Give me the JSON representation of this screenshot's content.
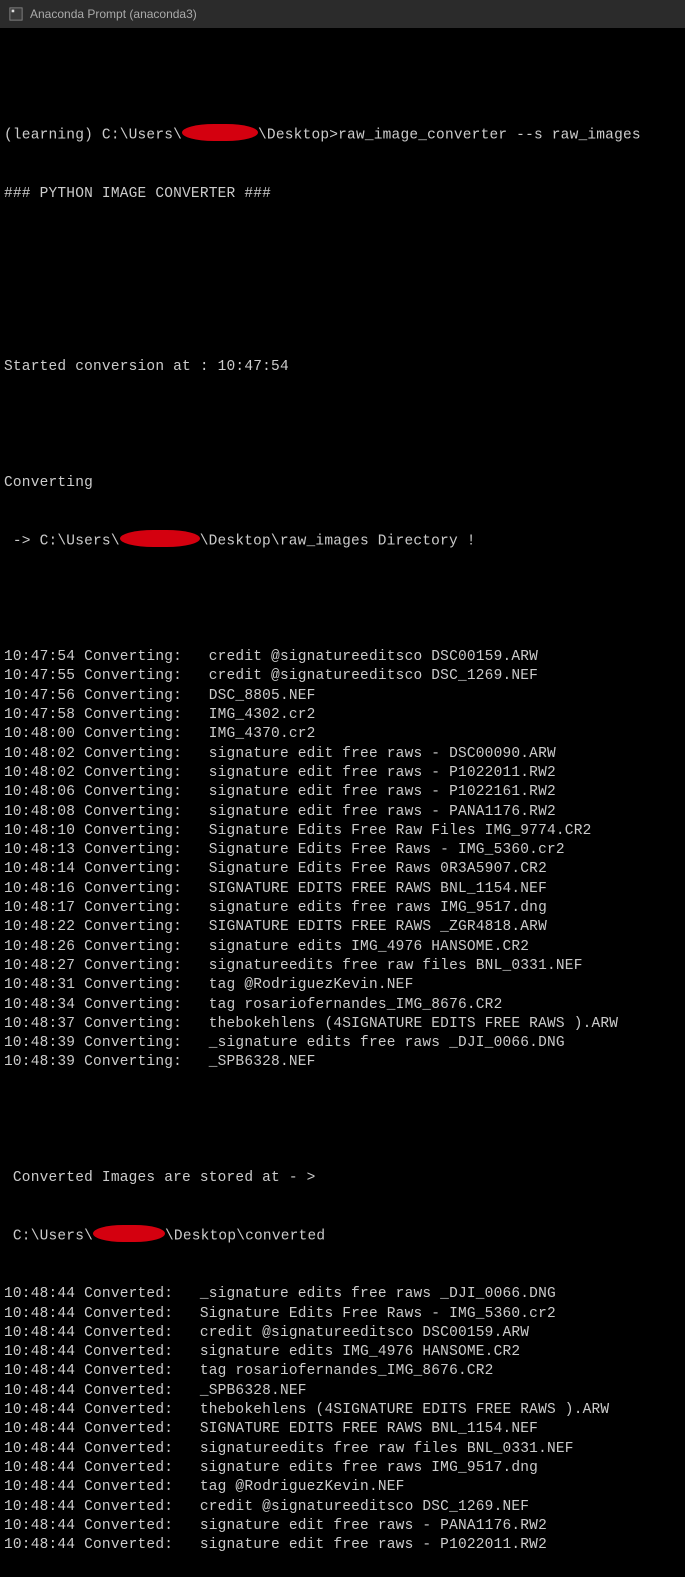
{
  "window": {
    "title": "Anaconda Prompt (anaconda3)"
  },
  "prompt": {
    "before_redact": "(learning) C:\\Users\\",
    "after_redact": "\\Desktop>raw_image_converter --s raw_images"
  },
  "header": "### PYTHON IMAGE CONVERTER ###",
  "started": "Started conversion at : 10:47:54",
  "converting_label": "Converting",
  "converting_dir": {
    "prefix": " -> C:\\Users\\",
    "suffix": "\\Desktop\\raw_images Directory !"
  },
  "converting_lines": [
    "10:47:54 Converting:   credit @signatureeditsco DSC00159.ARW",
    "10:47:55 Converting:   credit @signatureeditsco DSC_1269.NEF",
    "10:47:56 Converting:   DSC_8805.NEF",
    "10:47:58 Converting:   IMG_4302.cr2",
    "10:48:00 Converting:   IMG_4370.cr2",
    "10:48:02 Converting:   signature edit free raws - DSC00090.ARW",
    "10:48:02 Converting:   signature edit free raws - P1022011.RW2",
    "10:48:06 Converting:   signature edit free raws - P1022161.RW2",
    "10:48:08 Converting:   signature edit free raws - PANA1176.RW2",
    "10:48:10 Converting:   Signature Edits Free Raw Files IMG_9774.CR2",
    "10:48:13 Converting:   Signature Edits Free Raws - IMG_5360.cr2",
    "10:48:14 Converting:   Signature Edits Free Raws 0R3A5907.CR2",
    "10:48:16 Converting:   SIGNATURE EDITS FREE RAWS BNL_1154.NEF",
    "10:48:17 Converting:   signature edits free raws IMG_9517.dng",
    "10:48:22 Converting:   SIGNATURE EDITS FREE RAWS _ZGR4818.ARW",
    "10:48:26 Converting:   signature edits IMG_4976 HANSOME.CR2",
    "10:48:27 Converting:   signatureedits free raw files BNL_0331.NEF",
    "10:48:31 Converting:   tag @RodriguezKevin.NEF",
    "10:48:34 Converting:   tag rosariofernandes_IMG_8676.CR2",
    "10:48:37 Converting:   thebokehlens (4SIGNATURE EDITS FREE RAWS ).ARW",
    "10:48:39 Converting:   _signature edits free raws _DJI_0066.DNG",
    "10:48:39 Converting:   _SPB6328.NEF"
  ],
  "stored_at": " Converted Images are stored at - >",
  "stored_path": {
    "prefix": " C:\\Users\\",
    "suffix": "\\Desktop\\converted"
  },
  "converted_lines": [
    "10:48:44 Converted:   _signature edits free raws _DJI_0066.DNG",
    "10:48:44 Converted:   Signature Edits Free Raws - IMG_5360.cr2",
    "10:48:44 Converted:   credit @signatureeditsco DSC00159.ARW",
    "10:48:44 Converted:   signature edits IMG_4976 HANSOME.CR2",
    "10:48:44 Converted:   tag rosariofernandes_IMG_8676.CR2",
    "10:48:44 Converted:   _SPB6328.NEF",
    "10:48:44 Converted:   thebokehlens (4SIGNATURE EDITS FREE RAWS ).ARW",
    "10:48:44 Converted:   SIGNATURE EDITS FREE RAWS BNL_1154.NEF",
    "10:48:44 Converted:   signatureedits free raw files BNL_0331.NEF",
    "10:48:44 Converted:   signature edits free raws IMG_9517.dng",
    "10:48:44 Converted:   tag @RodriguezKevin.NEF",
    "10:48:44 Converted:   credit @signatureeditsco DSC_1269.NEF",
    "10:48:44 Converted:   signature edit free raws - PANA1176.RW2",
    "10:48:44 Converted:   signature edit free raws - P1022011.RW2"
  ]
}
